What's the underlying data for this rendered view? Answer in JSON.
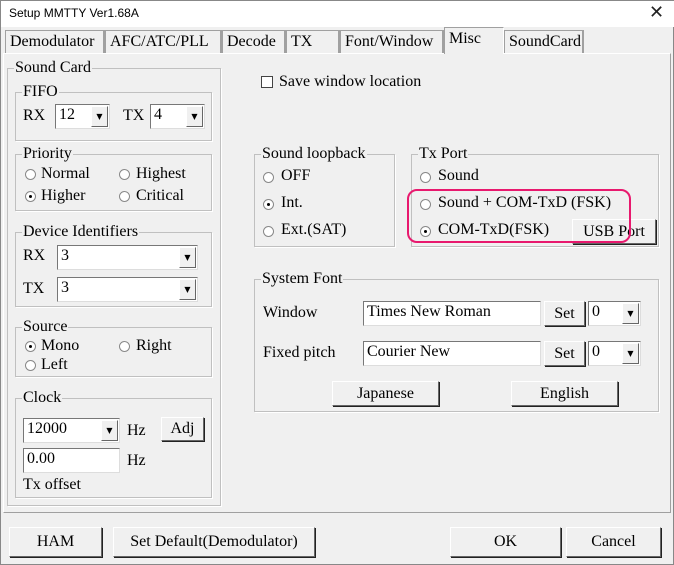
{
  "window": {
    "title": "Setup MMTTY Ver1.68A"
  },
  "tabs": [
    "Demodulator",
    "AFC/ATC/PLL",
    "Decode",
    "TX",
    "Font/Window",
    "Misc",
    "SoundCard"
  ],
  "sound_card": {
    "label": "Sound Card",
    "fifo": {
      "label": "FIFO",
      "rx_label": "RX",
      "rx_value": "12",
      "tx_label": "TX",
      "tx_value": "4"
    },
    "priority": {
      "label": "Priority",
      "options": [
        "Normal",
        "Highest",
        "Higher",
        "Critical"
      ],
      "selected": "Higher"
    },
    "device": {
      "label": "Device Identifiers",
      "rx_label": "RX",
      "rx_value": "3",
      "tx_label": "TX",
      "tx_value": "3"
    },
    "source": {
      "label": "Source",
      "options": [
        "Mono",
        "Right",
        "Left"
      ],
      "selected": "Mono"
    },
    "clock": {
      "label": "Clock",
      "value": "12000",
      "hz": "Hz",
      "adj": "Adj",
      "offset_value": "0.00",
      "offset_label": "Tx offset"
    }
  },
  "save_window": {
    "label": "Save window location",
    "checked": false
  },
  "loopback": {
    "label": "Sound loopback",
    "options": [
      "OFF",
      "Int.",
      "Ext.(SAT)"
    ],
    "selected": "Int."
  },
  "tx_port": {
    "label": "Tx Port",
    "options": [
      "Sound",
      "Sound + COM-TxD (FSK)",
      "COM-TxD(FSK)"
    ],
    "selected": "COM-TxD(FSK)",
    "usb_button": "USB Port",
    "highlight_color": "#e8196e"
  },
  "system_font": {
    "label": "System Font",
    "window_label": "Window",
    "window_font": "Times New Roman",
    "window_size": "0",
    "fixed_label": "Fixed pitch",
    "fixed_font": "Courier New",
    "fixed_size": "0",
    "set": "Set",
    "japanese": "Japanese",
    "english": "English"
  },
  "footer": {
    "ham": "HAM",
    "set_default": "Set Default(Demodulator)",
    "ok": "OK",
    "cancel": "Cancel"
  }
}
